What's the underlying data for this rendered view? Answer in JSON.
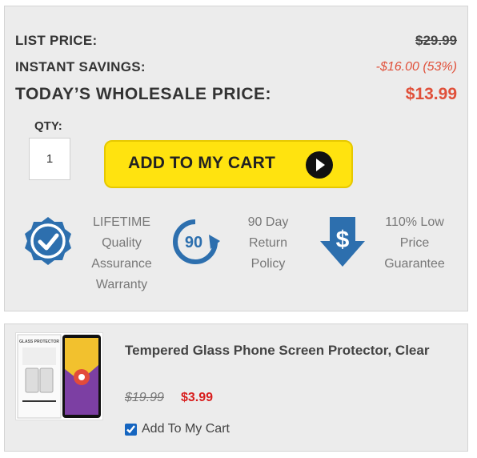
{
  "pricing": {
    "list_price_label": "LIST PRICE:",
    "list_price_value": "$29.99",
    "savings_label": "INSTANT SAVINGS:",
    "savings_value": "-$16.00 (53%)",
    "today_label": "TODAY’S WHOLESALE PRICE:",
    "today_value": "$13.99"
  },
  "qty": {
    "label": "QTY:",
    "value": "1"
  },
  "cart_button": {
    "label": "ADD TO MY CART",
    "icon": "play-circle-icon"
  },
  "features": [
    {
      "icon": "check-badge-icon",
      "lines": [
        "LIFETIME",
        "Quality",
        "Assurance",
        "Warranty"
      ]
    },
    {
      "icon": "ninety-day-return-icon",
      "icon_text": "90",
      "lines": [
        "90 Day",
        "Return",
        "Policy"
      ]
    },
    {
      "icon": "dollar-down-arrow-icon",
      "icon_text": "$",
      "lines": [
        "110% Low",
        "Price",
        "Guarantee"
      ]
    }
  ],
  "addon": {
    "image_caption": "GLASS PROTECTOR",
    "name": "Tempered Glass Phone Screen Protector, Clear",
    "old_price": "$19.99",
    "new_price": "$3.99",
    "checkbox_label": "Add To My Cart",
    "checked": true
  },
  "colors": {
    "accent_red": "#e0503a",
    "button_yellow": "#ffe30f",
    "icon_blue": "#2d6fae",
    "panel_gray": "#ececec"
  }
}
